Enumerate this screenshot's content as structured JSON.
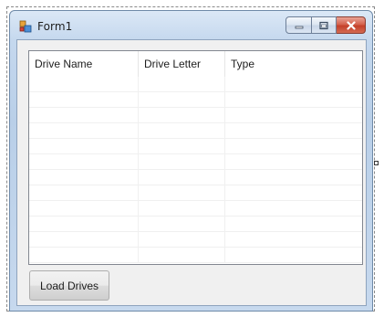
{
  "window": {
    "title": "Form1",
    "icon": "winforms-app-icon",
    "controls": [
      "minimize-icon",
      "restore-icon",
      "close-icon"
    ]
  },
  "listview": {
    "columns": [
      "Drive Name",
      "Drive Letter",
      "Type"
    ],
    "rows": []
  },
  "buttons": {
    "load_label": "Load Drives"
  },
  "colors": {
    "frame_accent": "#c5d8ee",
    "close_button": "#c4402a",
    "client_background": "#f0f0f0"
  }
}
